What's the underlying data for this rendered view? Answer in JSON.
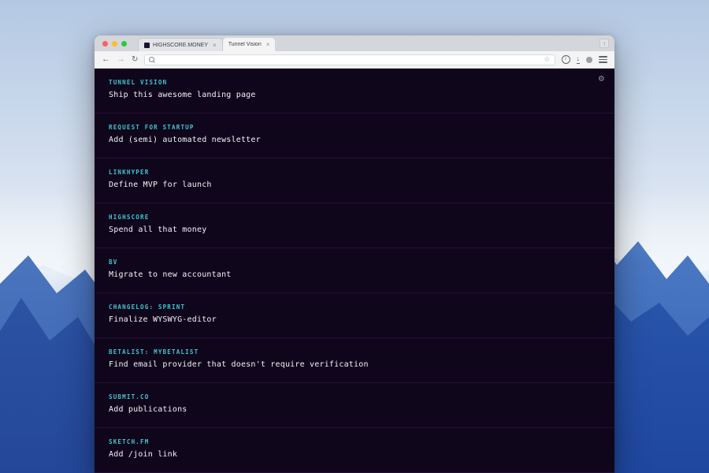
{
  "browser": {
    "tabs": [
      {
        "label": "HIGHSCORE.MONEY"
      },
      {
        "label": "Tunnel Vision"
      }
    ],
    "address_bar": {
      "value": ""
    },
    "icons": {
      "back": "←",
      "forward": "→",
      "reload": "↻",
      "close_tab": "×",
      "star": "☆",
      "info": "i",
      "download": "↓",
      "strip_button": "↑"
    }
  },
  "page": {
    "accent_color": "#3ec6cd",
    "background_color": "#10061c",
    "icons": {
      "gear": "⚙"
    },
    "items": [
      {
        "project": "TUNNEL VISION",
        "task": "Ship this awesome landing page"
      },
      {
        "project": "REQUEST FOR STARTUP",
        "task": "Add (semi) automated newsletter"
      },
      {
        "project": "LINKHYPER",
        "task": "Define MVP for launch"
      },
      {
        "project": "HIGHSCORE",
        "task": "Spend all that money"
      },
      {
        "project": "BV",
        "task": "Migrate to new accountant"
      },
      {
        "project": "CHANGELOG: SPRINT",
        "task": "Finalize WYSWYG-editor"
      },
      {
        "project": "BETALIST: MYBETALIST",
        "task": "Find email provider that doesn't require verification"
      },
      {
        "project": "SUBMIT.CO",
        "task": "Add publications"
      },
      {
        "project": "SKETCH.FM",
        "task": "Add /join link"
      }
    ]
  }
}
